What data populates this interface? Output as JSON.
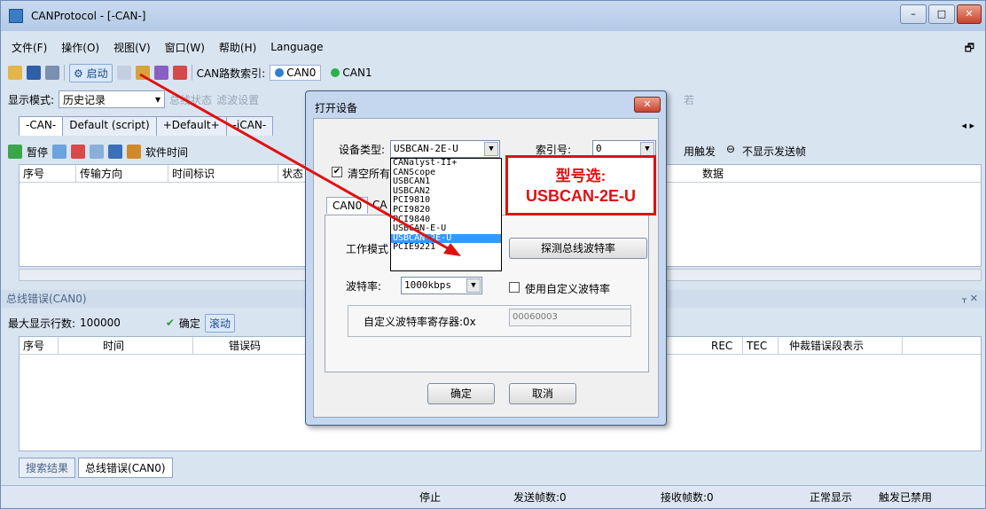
{
  "window": {
    "title": "CANProtocol - [-CAN-]",
    "controls": [
      "–",
      "□",
      "✕"
    ]
  },
  "menu": [
    "文件(F)",
    "操作(O)",
    "视图(V)",
    "窗口(W)",
    "帮助(H)",
    "Language"
  ],
  "toolbar1": {
    "start_label": "启动",
    "can_index_label": "CAN路数索引:",
    "can0": "CAN0",
    "can1": "CAN1"
  },
  "toolbar2": {
    "display_mode_label": "显示模式:",
    "display_mode_value": "历史记录",
    "bus_state": "总线状态",
    "filter": "滤波设置",
    "end_fragment": "若"
  },
  "tabs": [
    "-CAN-",
    "Default (script)",
    "+Default+",
    "-iCAN-"
  ],
  "toolbar3": {
    "pause": "暂停",
    "soft_time": "软件时间",
    "trigger": "用触发",
    "no_send": "不显示发送帧"
  },
  "table_headers": [
    "序号",
    "传输方向",
    "时间标识",
    "状态",
    "数据"
  ],
  "bus_error": {
    "section_title": "总线错误(CAN0)",
    "max_rows_label": "最大显示行数:",
    "max_rows_value": "100000",
    "confirm": "确定",
    "scroll": "滚动",
    "headers": [
      "序号",
      "时间",
      "错误码",
      "REC",
      "TEC",
      "仲裁错误段表示"
    ]
  },
  "bottom_tabs": [
    "搜索结果",
    "总线错误(CAN0)"
  ],
  "status": {
    "state": "停止",
    "sent": "发送帧数:0",
    "received": "接收帧数:0",
    "display": "正常显示",
    "trigger": "触发已禁用"
  },
  "dialog": {
    "title": "打开设备",
    "device_type_label": "设备类型:",
    "device_type_value": "USBCAN-2E-U",
    "index_label": "索引号:",
    "index_value": "0",
    "clear_all_label": "清空所有",
    "tabs": [
      "CAN0",
      "CA"
    ],
    "work_mode_label": "工作模式",
    "detect_baud": "探测总线波特率",
    "baud_label": "波特率:",
    "baud_value": "1000kbps",
    "custom_baud": "使用自定义波特率",
    "custom_reg_label": "自定义波特率寄存器:0x",
    "custom_reg_value": "00060003",
    "ok": "确定",
    "cancel": "取消",
    "device_options": [
      "CANalyst-II+",
      "CANScope",
      "USBCAN1",
      "USBCAN2",
      "PCI9810",
      "PCI9820",
      "PCI9840",
      "USBCAN-E-U",
      "USBCAN-2E-U",
      "PCIE9221"
    ],
    "selected_option": "USBCAN-2E-U"
  },
  "callout": {
    "line1": "型号选:",
    "line2": "USBCAN-2E-U"
  },
  "colors": {
    "accent": "#e01010",
    "selection": "#3399ff",
    "window_bg": "#d9e4f1"
  }
}
